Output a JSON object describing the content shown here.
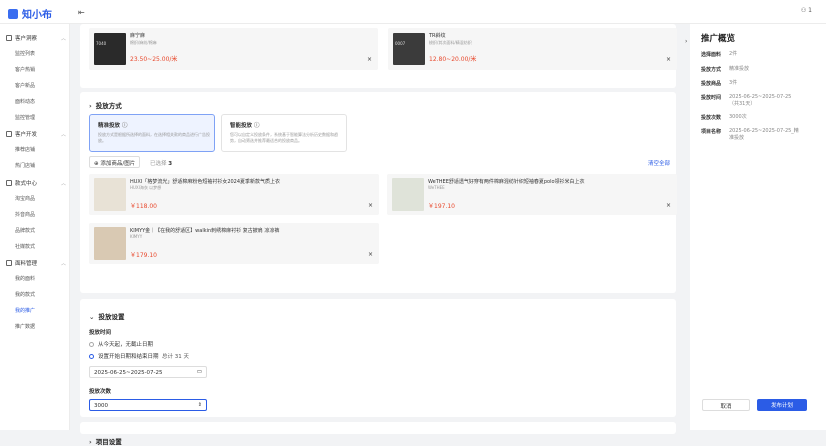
{
  "header": {
    "logo": "知小布",
    "user": "1"
  },
  "sidebar": {
    "groups": [
      {
        "label": "客户洞察",
        "items": [
          "监控列表",
          "客户热销",
          "客户新品",
          "面料动态",
          "监控管理"
        ]
      },
      {
        "label": "客户开发",
        "items": [
          "推荐店铺",
          "热门店铺"
        ]
      },
      {
        "label": "款式中心",
        "items": [
          "淘宝商品",
          "抖音商品",
          "品牌款式",
          "社媒款式"
        ]
      },
      {
        "label": "面料管理",
        "items": [
          "我的面料",
          "我的款式",
          "我的推广",
          "推广数据"
        ]
      }
    ]
  },
  "fabrics": [
    {
      "name": "麻宁麻",
      "desc": "棉织/麻纺/棉麻",
      "price": "23.50~25.00/米",
      "thumb_text": "7040"
    },
    {
      "name": "TR斜纹",
      "desc": "梭织/其次面料/精混纺织",
      "price": "12.80~20.00/米",
      "thumb_text": "0007"
    }
  ],
  "delivery": {
    "title": "投放方式",
    "modes": [
      {
        "title": "精准投放",
        "desc": "投放方式是根据所选择的面料，在选择相关款的商品进行广告投放。",
        "selected": true
      },
      {
        "title": "智能投放",
        "desc": "您可以自定义投放条件，系统基于智能算法分析历史数据和趋势，自动筛选并推荐最适合的投放商品。",
        "selected": false
      }
    ],
    "add_button": "添加商品/图片",
    "selected_label": "已选择",
    "selected_count": "3",
    "clear_all": "清空全部",
    "products": [
      {
        "title": "HUXI「格梦流光」舒适棉麻粉色短袖衬衫女2024夏季新款气质上衣",
        "brand": "HUXI海衣 以梦想",
        "price": "￥118.00"
      },
      {
        "title": "WeTHEE舒适透气好穿有两件棉麻混纺针织短袖春夏polo领衫米白上衣",
        "brand": "WeTHEE",
        "price": "￥197.10"
      },
      {
        "title": "KIMYY金｜【在我的舒适区】walkin刺绣棉麻衬衫 复古披肩 凉凉裤",
        "brand": "KIMYY",
        "price": "￥179.10"
      }
    ]
  },
  "settings": {
    "title": "投放设置",
    "period_label": "投放时间",
    "options": [
      "从今天起，无截止日期",
      "设置开始日期和结束日期"
    ],
    "total": "总计 31 天",
    "date_range": "2025-06-25~2025-07-25",
    "count_label": "投放次数",
    "count_value": "3000"
  },
  "project": {
    "title": "项目设置"
  },
  "summary": {
    "title": "推广概览",
    "rows": [
      {
        "k": "选择面料",
        "v": "2件"
      },
      {
        "k": "投放方式",
        "v": "精准投放"
      },
      {
        "k": "投放商品",
        "v": "3件"
      },
      {
        "k": "投放时间",
        "v": "2025-06-25~2025-07-25（共31天）"
      },
      {
        "k": "投放次数",
        "v": "3000次"
      },
      {
        "k": "项目名称",
        "v": "2025-06-25~2025-07-25_精准投放"
      }
    ],
    "cancel": "取消",
    "publish": "发布计划"
  },
  "colors": {
    "accent": "#2b5ce6",
    "price": "#e8492d"
  }
}
